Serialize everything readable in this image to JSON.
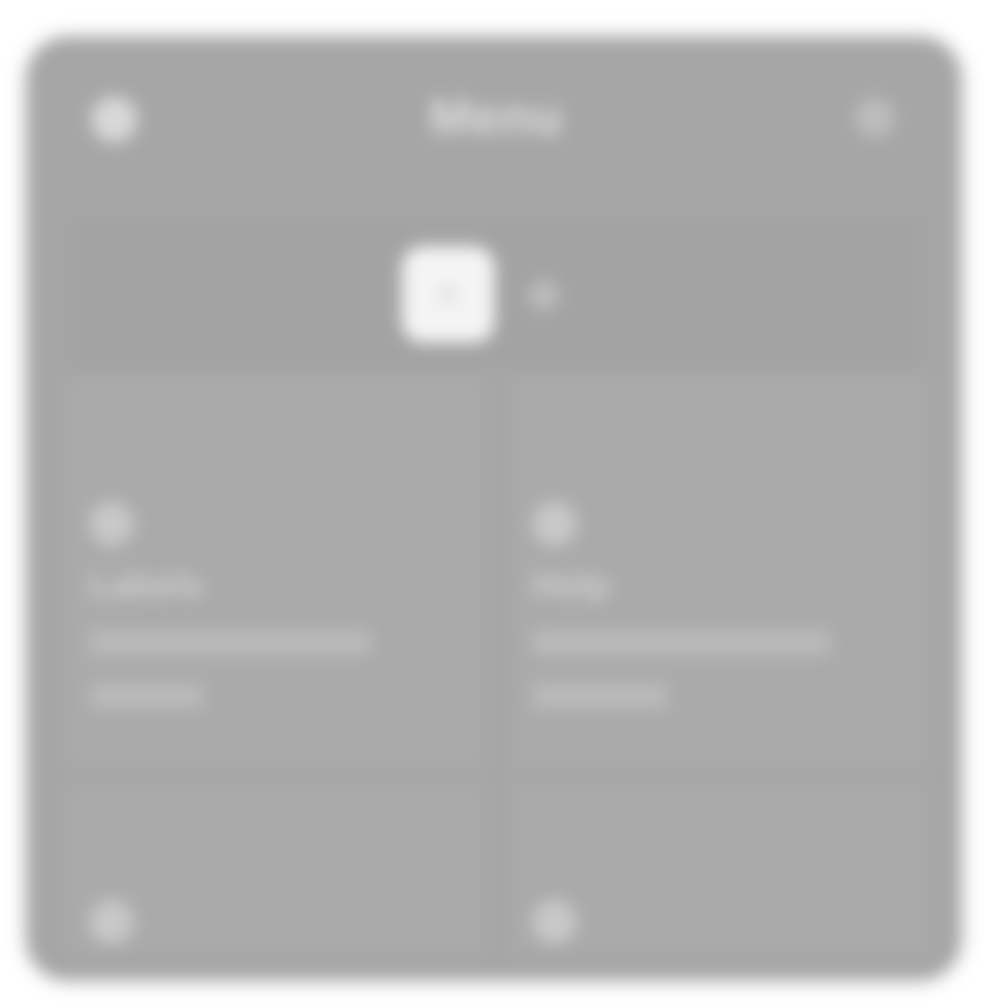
{
  "header": {
    "title": "Menu",
    "left_icon": "user-icon",
    "right_icon": "settings-icon"
  },
  "top_strip": {
    "tile_icon": "app-tile-icon",
    "side_icon": "dot-icon"
  },
  "cards": [
    {
      "icon": "item-icon",
      "title": "Labels",
      "line_1": "",
      "line_2": ""
    },
    {
      "icon": "item-icon",
      "title": "Help",
      "line_1": "",
      "line_2": ""
    },
    {
      "icon": "item-icon",
      "title": ""
    },
    {
      "icon": "item-icon",
      "title": ""
    }
  ],
  "colors": {
    "panel": "#a6a6a6",
    "tile": "#f4f4f4",
    "text": "#dedede"
  }
}
